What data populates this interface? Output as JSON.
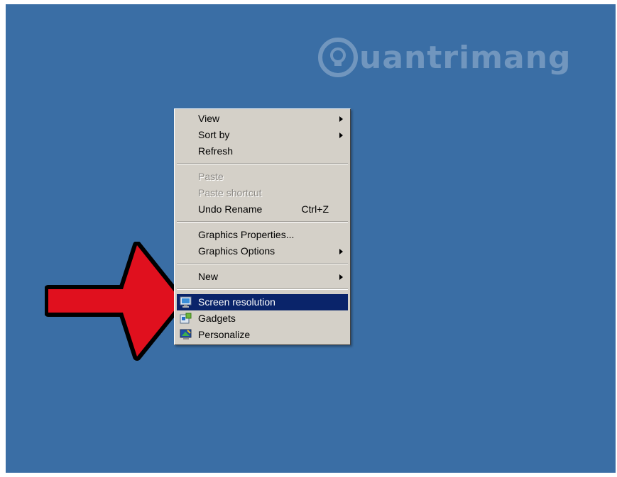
{
  "watermark": {
    "text": "uantrimang",
    "logo_icon": "lightbulb-icon"
  },
  "context_menu": {
    "group1": [
      {
        "label": "View",
        "has_submenu": true
      },
      {
        "label": "Sort by",
        "has_submenu": true
      },
      {
        "label": "Refresh",
        "has_submenu": false
      }
    ],
    "group2": [
      {
        "label": "Paste",
        "disabled": true
      },
      {
        "label": "Paste shortcut",
        "disabled": true
      },
      {
        "label": "Undo Rename",
        "shortcut": "Ctrl+Z",
        "disabled": false
      }
    ],
    "group3": [
      {
        "label": "Graphics Properties...",
        "has_submenu": false
      },
      {
        "label": "Graphics Options",
        "has_submenu": true
      }
    ],
    "group4": [
      {
        "label": "New",
        "has_submenu": true
      }
    ],
    "group5": [
      {
        "label": "Screen resolution",
        "icon": "monitor-icon",
        "selected": true
      },
      {
        "label": "Gadgets",
        "icon": "gadgets-icon"
      },
      {
        "label": "Personalize",
        "icon": "personalize-icon"
      }
    ]
  },
  "colors": {
    "desktop": "#3a6ea5",
    "menu_bg": "#d4d0c8",
    "highlight": "#0a246a",
    "pointer_arrow": "#e0101e"
  },
  "annotation": {
    "icon": "red-arrow-icon"
  }
}
